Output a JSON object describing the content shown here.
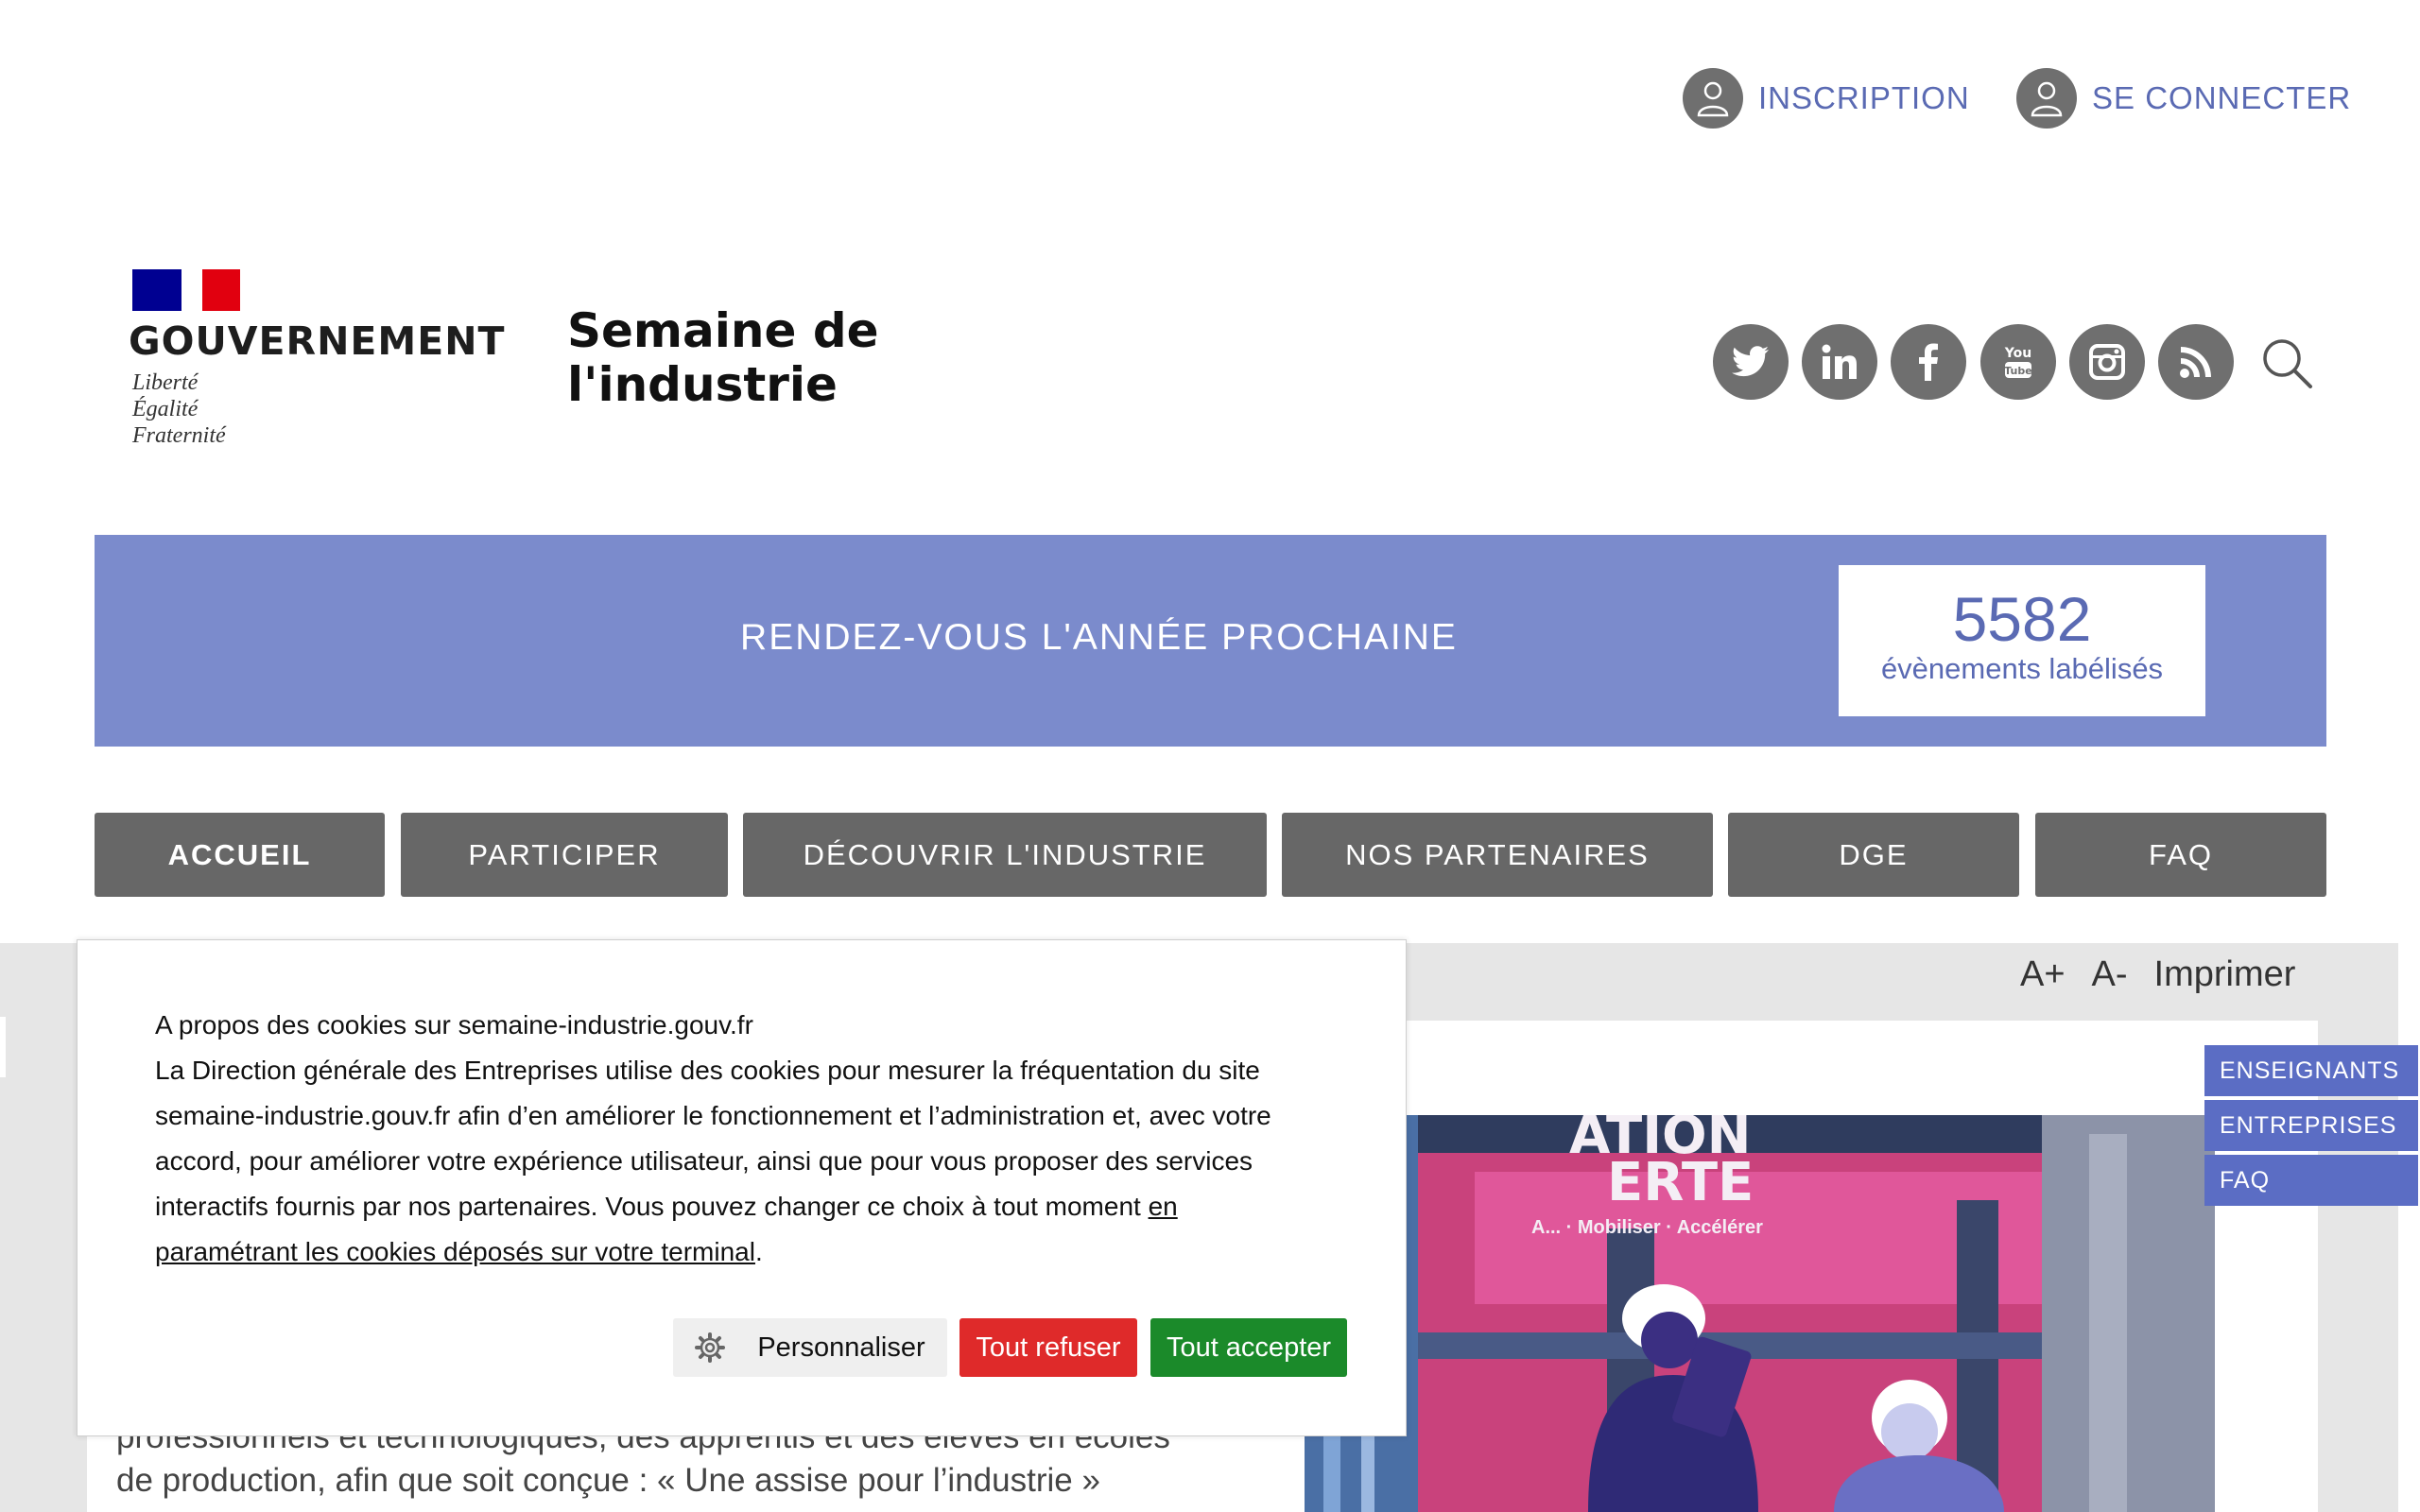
{
  "account": {
    "inscription_label": "INSCRIPTION",
    "connect_label": "SE CONNECTER"
  },
  "logo": {
    "brand": "GOUVERNEMENT",
    "motto_1": "Liberté",
    "motto_2": "Égalité",
    "motto_3": "Fraternité"
  },
  "site": {
    "title_line_1": "Semaine de",
    "title_line_2": "l'industrie"
  },
  "social_icons": [
    "twitter-icon",
    "linkedin-icon",
    "facebook-icon",
    "youtube-icon",
    "instagram-icon",
    "rss-icon"
  ],
  "banner": {
    "text": "RENDEZ-VOUS L'ANNÉE PROCHAINE",
    "counter_value": "5582",
    "counter_label": "évènements labélisés",
    "color": "#7b8bcc"
  },
  "nav": {
    "items": [
      {
        "label": "ACCUEIL",
        "active": true
      },
      {
        "label": "PARTICIPER"
      },
      {
        "label": "DÉCOUVRIR L'INDUSTRIE"
      },
      {
        "label": "NOS PARTENAIRES"
      },
      {
        "label": "DGE"
      },
      {
        "label": "FAQ"
      }
    ]
  },
  "tools": {
    "increase_font": "A+",
    "decrease_font": "A-",
    "print": "Imprimer"
  },
  "side_links": [
    "ENSEIGNANTS",
    "ENTREPRISES",
    "FAQ"
  ],
  "hero": {
    "poster_line_1": "ATION",
    "poster_line_2": "ERTE",
    "poster_tagline": "A... · Mobiliser · Accélérer"
  },
  "body": {
    "line_1": "professionnels et technologiques, des apprentis et des élèves en écoles",
    "line_2": "de production, afin que soit conçue : « Une assise pour l’industrie »"
  },
  "cookie": {
    "heading": "A propos des cookies sur semaine-industrie.gouv.fr",
    "text": "La Direction générale des Entreprises utilise des cookies pour mesurer la fréquentation du site semaine-industrie.gouv.fr afin d’en améliorer le fonctionnement et l’administration et, avec votre accord, pour améliorer votre expérience utilisateur, ainsi que pour vous proposer des services interactifs fournis par nos partenaires. Vous pouvez changer ce choix à tout moment ",
    "link": "en paramétrant les cookies déposés sur votre terminal",
    "end": ".",
    "customize_label": "Personnaliser",
    "refuse_label": "Tout refuser",
    "accept_label": "Tout accepter",
    "refuse_color": "#df2a2a",
    "accept_color": "#1b8a2a"
  }
}
